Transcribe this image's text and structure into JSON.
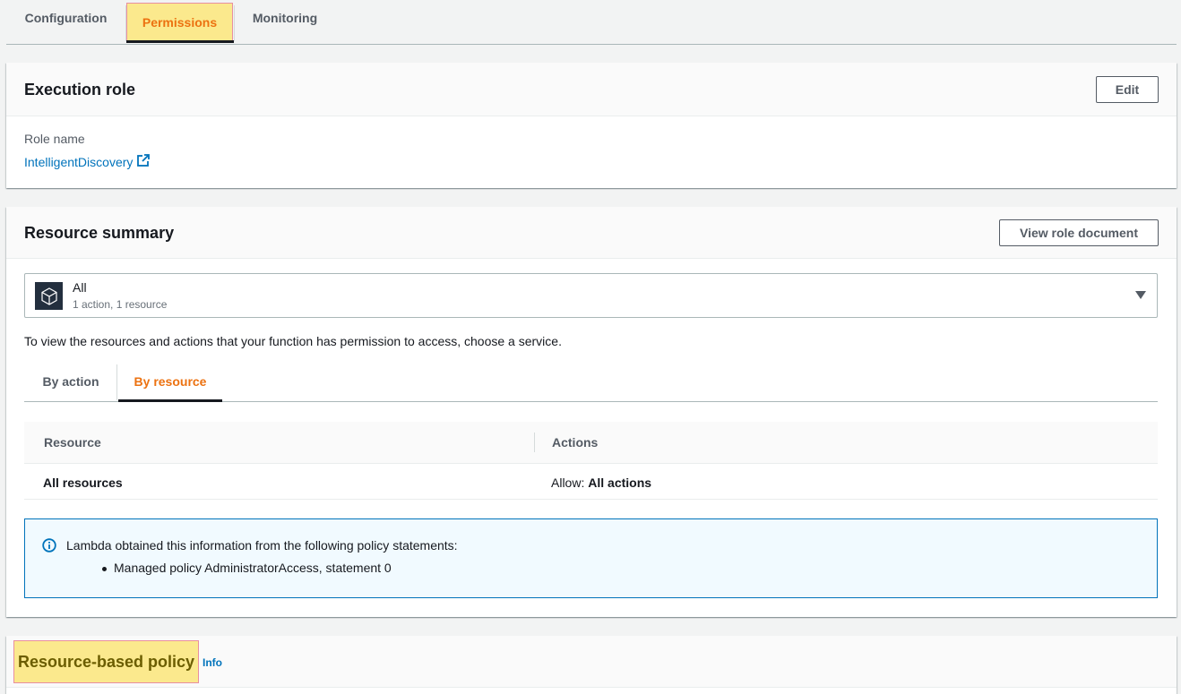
{
  "top_tabs": [
    {
      "label": "Configuration"
    },
    {
      "label": "Permissions"
    },
    {
      "label": "Monitoring"
    }
  ],
  "execution_role": {
    "title": "Execution role",
    "edit_label": "Edit",
    "role_name_label": "Role name",
    "role_name": "IntelligentDiscovery"
  },
  "resource_summary": {
    "title": "Resource summary",
    "view_doc_label": "View role document",
    "service_select": {
      "name": "All",
      "sub": "1 action, 1 resource"
    },
    "helper_text": "To view the resources and actions that your function has permission to access, choose a service.",
    "tabs": [
      {
        "label": "By action"
      },
      {
        "label": "By resource"
      }
    ],
    "table": {
      "headers": [
        "Resource",
        "Actions"
      ],
      "rows": [
        {
          "resource": "All resources",
          "actions_prefix": "Allow:",
          "actions": "All actions"
        }
      ]
    },
    "alert": {
      "text": "Lambda obtained this information from the following policy statements:",
      "items": [
        "Managed policy AdministratorAccess, statement 0"
      ]
    }
  },
  "resource_based_policy": {
    "title": "Resource-based policy",
    "info_label": "Info"
  },
  "colors": {
    "accent": "#ec7211",
    "link": "#0073bb",
    "highlight": "#fbe98d",
    "highlight_border": "#e88fa0"
  }
}
